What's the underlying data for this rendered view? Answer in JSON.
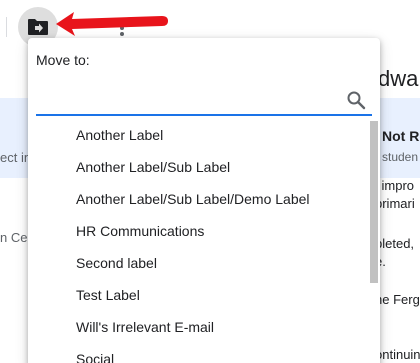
{
  "background": {
    "heading": "dwa",
    "rows": [
      {
        "snippet": "ect in"
      },
      {
        "snippet": "n Ce"
      }
    ],
    "email": {
      "subject": "Not Re",
      "sender": "studen",
      "body_lines": [
        "l impro",
        "primari",
        "pleted,",
        "e.",
        "he Ferg",
        "ontinuin"
      ]
    }
  },
  "move_to": {
    "header": "Move to:",
    "search": {
      "value": "",
      "placeholder": ""
    },
    "labels": [
      "Another Label",
      "Another Label/Sub Label",
      "Another Label/Sub Label/Demo Label",
      "HR Communications",
      "Second label",
      "Test Label",
      "Will's Irrelevant E-mail",
      "Social"
    ]
  },
  "icons": {
    "move_to": "folder-move-icon",
    "search": "search-icon",
    "annotation": "red-arrow-annotation",
    "more": "more-vertical-icon"
  },
  "colors": {
    "accent": "#1a73e8",
    "selected_row": "#e8f0fe",
    "button_pressed": "#dedede",
    "arrow": "#e8141b"
  }
}
